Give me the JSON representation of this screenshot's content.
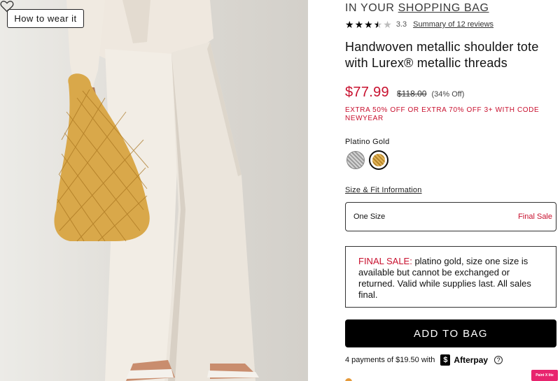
{
  "image": {
    "wear_button_label": "How to wear it"
  },
  "product": {
    "bag_prefix": "IN YOUR",
    "bag_link": "SHOPPING BAG",
    "rating_value": "3.3",
    "rating_stars": 3.5,
    "reviews_link": "Summary of 12 reviews",
    "title": "Handwoven metallic shoulder tote with Lurex® metallic threads",
    "price_sale": "$77.99",
    "price_original": "$118.00",
    "price_off": "(34% Off)",
    "promo": "EXTRA 50% OFF OR EXTRA 70% OFF 3+ WITH CODE NEWYEAR",
    "color_label": "Platino Gold",
    "swatches": [
      "silver",
      "platino-gold"
    ],
    "size_fit_link": "Size & Fit Information",
    "size_name": "One Size",
    "size_final": "Final Sale",
    "final_label": "FINAL SALE:",
    "final_text": " platino gold, size one size is available but cannot be exchanged or returned. Valid while supplies last. All sales final.",
    "add_button": "ADD TO BAG",
    "afterpay_text": "4 payments of $19.50 with",
    "afterpay_logo": "$",
    "afterpay_name": "Afterpay",
    "afterpay_info": "?"
  },
  "extension_badge": "Paint X lite",
  "colors": {
    "sale_red": "#c8102e",
    "button_black": "#000000",
    "gold": "#d9a84a"
  }
}
